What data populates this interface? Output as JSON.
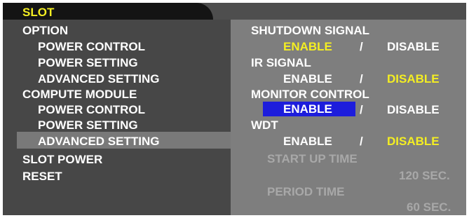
{
  "menu": {
    "tab_label": "SLOT",
    "items": [
      {
        "label": "OPTION"
      },
      {
        "label": "POWER CONTROL"
      },
      {
        "label": "POWER SETTING"
      },
      {
        "label": "ADVANCED SETTING"
      },
      {
        "label": "COMPUTE MODULE"
      },
      {
        "label": "POWER CONTROL"
      },
      {
        "label": "POWER SETTING"
      },
      {
        "label": "ADVANCED SETTING"
      },
      {
        "label": "SLOT POWER"
      },
      {
        "label": "RESET"
      }
    ],
    "selected_item": "ADVANCED SETTING"
  },
  "settings": {
    "shutdown_signal": {
      "label": "SHUTDOWN SIGNAL",
      "enable": "ENABLE",
      "sep": "/",
      "disable": "DISABLE",
      "value": "ENABLE"
    },
    "ir_signal": {
      "label": "IR SIGNAL",
      "enable": "ENABLE",
      "sep": "/",
      "disable": "DISABLE",
      "value": "DISABLE"
    },
    "monitor_control": {
      "label": "MONITOR CONTROL",
      "enable": "ENABLE",
      "sep": "/",
      "disable": "DISABLE",
      "value": "ENABLE"
    },
    "wdt": {
      "label": "WDT",
      "enable": "ENABLE",
      "sep": "/",
      "disable": "DISABLE",
      "value": "DISABLE"
    },
    "start_up_time": {
      "label": "START UP TIME",
      "value": "120 SEC."
    },
    "period_time": {
      "label": "PERIOD TIME",
      "value": "60 SEC."
    }
  },
  "colors": {
    "selected_value": "#f4ee22",
    "cursor_highlight": "#1d1ddc",
    "disabled_text": "#a8a8a8"
  }
}
